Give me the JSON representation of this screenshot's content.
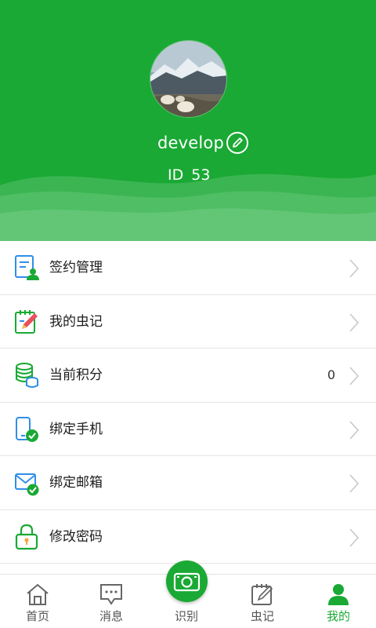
{
  "profile": {
    "username": "develop",
    "id_label": "ID",
    "id_value": "53"
  },
  "menu": [
    {
      "label": "签约管理",
      "value": "",
      "icon": "contract-manage-icon"
    },
    {
      "label": "我的虫记",
      "value": "",
      "icon": "notebook-pencil-icon"
    },
    {
      "label": "当前积分",
      "value": "0",
      "icon": "coins-stack-icon"
    },
    {
      "label": "绑定手机",
      "value": "",
      "icon": "phone-check-icon"
    },
    {
      "label": "绑定邮箱",
      "value": "",
      "icon": "mail-check-icon"
    },
    {
      "label": "修改密码",
      "value": "",
      "icon": "lock-icon"
    }
  ],
  "tabbar": {
    "tabs": [
      {
        "label": "首页",
        "icon": "home-icon"
      },
      {
        "label": "消息",
        "icon": "message-icon"
      },
      {
        "label": "识别",
        "icon": "camera-icon"
      },
      {
        "label": "虫记",
        "icon": "notebook-icon"
      },
      {
        "label": "我的",
        "icon": "user-icon"
      }
    ],
    "active_index": 4
  },
  "colors": {
    "brand_green": "#1aa934",
    "icon_blue": "#2f8fe8",
    "text_dark": "#1d1d1d",
    "tab_inactive": "#555555"
  }
}
